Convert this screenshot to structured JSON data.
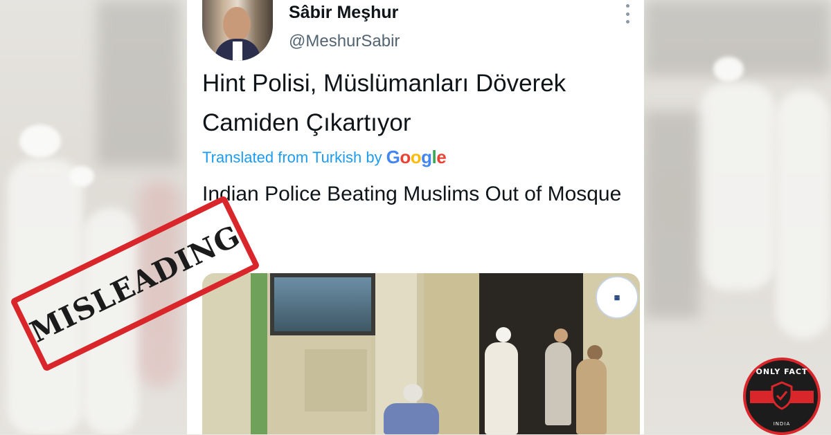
{
  "tweet": {
    "display_name": "Sâbir Meşhur",
    "handle": "@MeshurSabir",
    "text_lines": [
      "Hint Polisi, Müslümanları Döverek",
      "Camiden Çıkartıyor"
    ],
    "translated_from": "Translated from Turkish by",
    "translation_provider": "Google",
    "translation": "Indian Police Beating Muslims Out of Mosque",
    "more_icon": "more-vertical-icon"
  },
  "stamp": {
    "text": "MISLEADING",
    "color": "#d8262b"
  },
  "badge": {
    "top_text": "ONLY FACT",
    "bottom_text": "INDIA",
    "icon": "shield-check-icon",
    "color": "#d8262b"
  },
  "colors": {
    "link_blue": "#1d9bf0",
    "text": "#0f1419",
    "secondary": "#536471"
  }
}
